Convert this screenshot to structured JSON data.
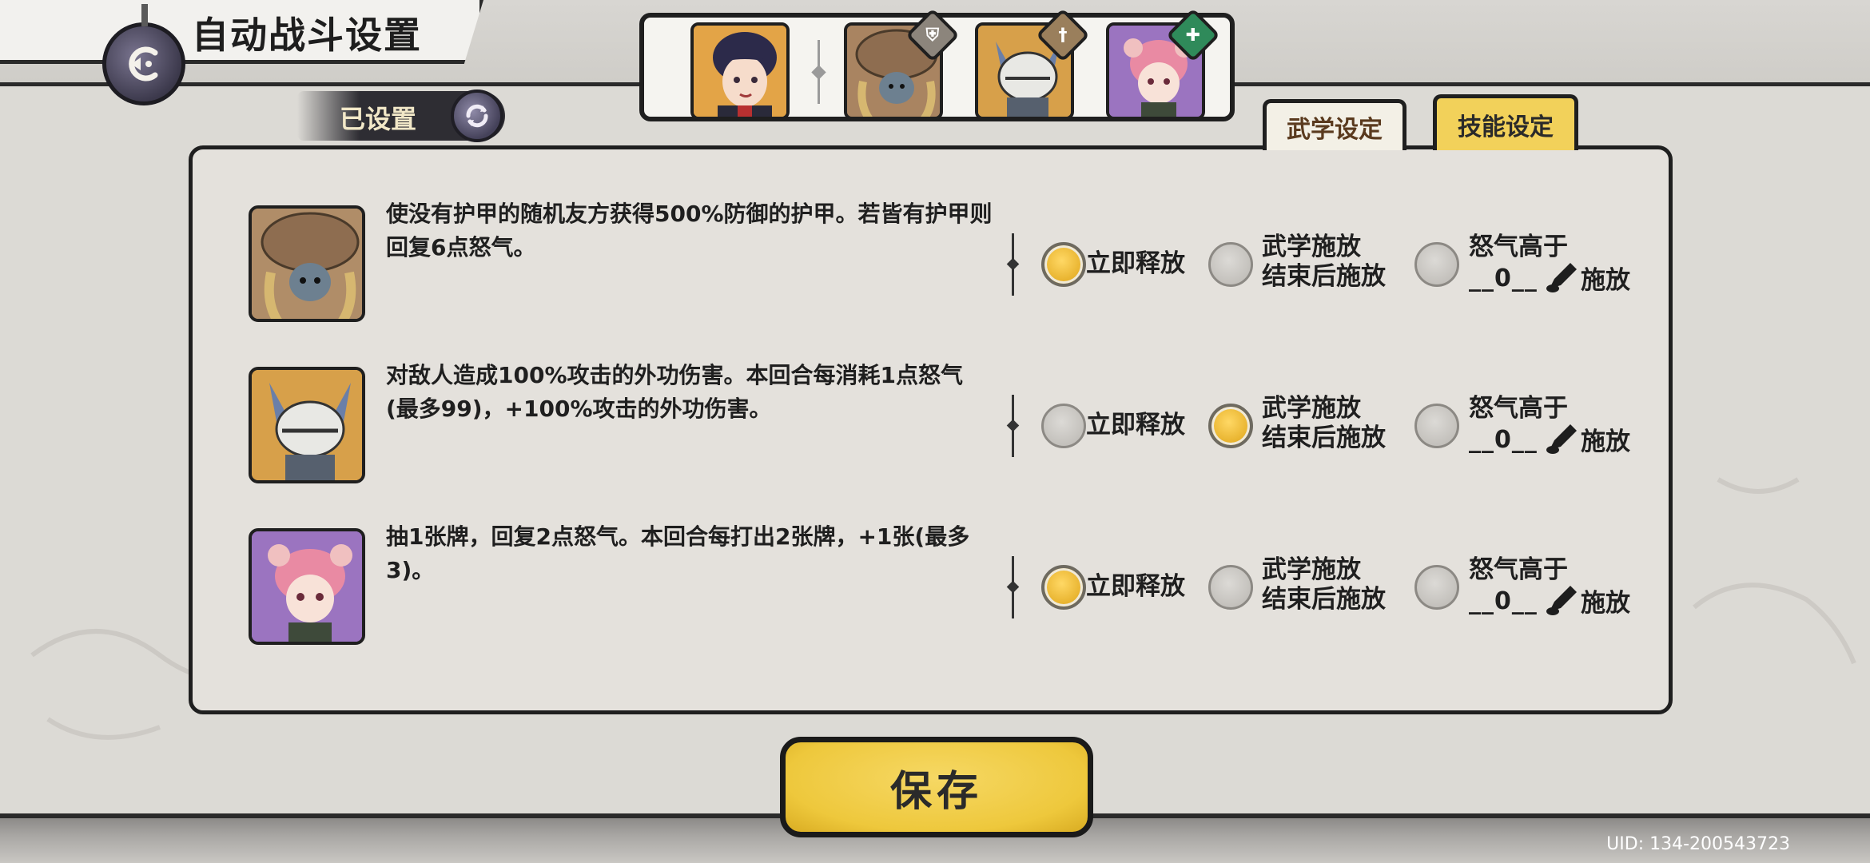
{
  "header": {
    "title": "自动战斗设置",
    "status_label": "已设置"
  },
  "tabs": [
    {
      "label": "武学设定",
      "active": false
    },
    {
      "label": "技能设定",
      "active": true
    }
  ],
  "skills": [
    {
      "description": "使没有护甲的随机友方获得500%防御的护甲。若皆有护甲则回复6点怒气。",
      "selected": "immediate",
      "threshold": "__0__"
    },
    {
      "description": "对敌人造成100%攻击的外功伤害。本回合每消耗1点怒气(最多99)，+100%攻击的外功伤害。",
      "selected": "after_martial",
      "threshold": "__0__"
    },
    {
      "description": "抽1张牌，回复2点怒气。本回合每打出2张牌，+1张(最多3)。",
      "selected": "immediate",
      "threshold": "__0__"
    }
  ],
  "options": {
    "immediate": "立即释放",
    "after_martial_line1": "武学施放",
    "after_martial_line2": "结束后施放",
    "rage_line1": "怒气高于",
    "rage_cast": "施放"
  },
  "save_label": "保存",
  "uid": "UID:  134-200543723",
  "colors": {
    "accent_gold": "#f2d15a",
    "panel_bg": "#e4e1dc",
    "outline": "#1f1f1f"
  }
}
